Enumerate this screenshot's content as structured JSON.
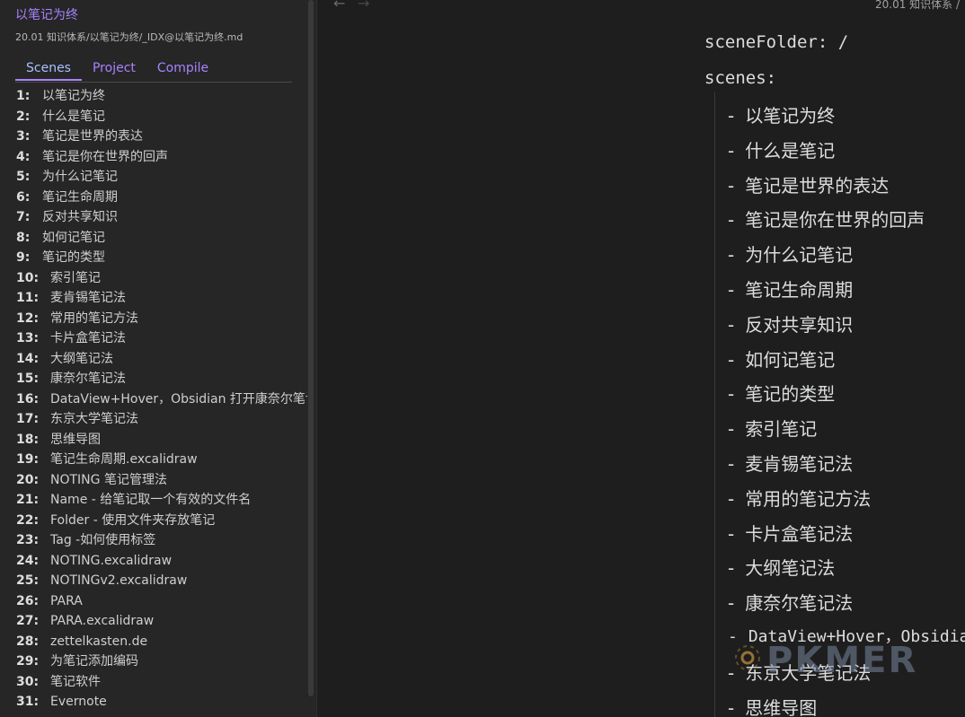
{
  "sidebar": {
    "project_title": "以笔记为终",
    "project_path": "20.01 知识体系/以笔记为终/_IDX@以笔记为终.md",
    "tabs": [
      {
        "label": "Scenes",
        "active": true
      },
      {
        "label": "Project",
        "active": false
      },
      {
        "label": "Compile",
        "active": false
      }
    ],
    "scenes": [
      {
        "num": "1:",
        "name": "以笔记为终"
      },
      {
        "num": "2:",
        "name": "什么是笔记"
      },
      {
        "num": "3:",
        "name": "笔记是世界的表达"
      },
      {
        "num": "4:",
        "name": "笔记是你在世界的回声"
      },
      {
        "num": "5:",
        "name": "为什么记笔记"
      },
      {
        "num": "6:",
        "name": "笔记生命周期"
      },
      {
        "num": "7:",
        "name": "反对共享知识"
      },
      {
        "num": "8:",
        "name": "如何记笔记"
      },
      {
        "num": "9:",
        "name": "笔记的类型"
      },
      {
        "num": "10:",
        "name": "索引笔记"
      },
      {
        "num": "11:",
        "name": "麦肯锡笔记法"
      },
      {
        "num": "12:",
        "name": "常用的笔记方法"
      },
      {
        "num": "13:",
        "name": "卡片盒笔记法"
      },
      {
        "num": "14:",
        "name": "大纲笔记法"
      },
      {
        "num": "15:",
        "name": "康奈尔笔记法"
      },
      {
        "num": "16:",
        "name": "DataView+Hover，Obsidian 打开康奈尔笔记"
      },
      {
        "num": "17:",
        "name": "东京大学笔记法"
      },
      {
        "num": "18:",
        "name": "思维导图"
      },
      {
        "num": "19:",
        "name": "笔记生命周期.excalidraw"
      },
      {
        "num": "20:",
        "name": "NOTING 笔记管理法"
      },
      {
        "num": "21:",
        "name": "Name - 给笔记取一个有效的文件名"
      },
      {
        "num": "22:",
        "name": "Folder - 使用文件夹存放笔记"
      },
      {
        "num": "23:",
        "name": "Tag -如何使用标签"
      },
      {
        "num": "24:",
        "name": "NOTING.excalidraw"
      },
      {
        "num": "25:",
        "name": "NOTINGv2.excalidraw"
      },
      {
        "num": "26:",
        "name": "PARA"
      },
      {
        "num": "27:",
        "name": "PARA.excalidraw"
      },
      {
        "num": "28:",
        "name": "zettelkasten.de"
      },
      {
        "num": "29:",
        "name": "为笔记添加编码"
      },
      {
        "num": "30:",
        "name": "笔记软件"
      },
      {
        "num": "31:",
        "name": "Evernote"
      }
    ]
  },
  "editor": {
    "view_title": "20.01 知识体系 /",
    "line_scene_folder": "sceneFolder: /",
    "line_scenes": "scenes:",
    "dash": "-",
    "items": [
      "以笔记为终",
      "什么是笔记",
      "笔记是世界的表达",
      "笔记是你在世界的回声",
      "为什么记笔记",
      "笔记生命周期",
      "反对共享知识",
      "如何记笔记",
      "笔记的类型",
      "索引笔记",
      "麦肯锡笔记法",
      "常用的笔记方法",
      "卡片盒笔记法",
      "大纲笔记法",
      "康奈尔笔记法",
      "DataView+Hover，Obsidian 打开康奈尔笔记",
      "东京大学笔记法",
      "思维导图"
    ]
  },
  "watermark": {
    "text": "PKMER"
  },
  "colors": {
    "accent": "#a882ff",
    "background": "#1e1e1e",
    "sidebar": "#262626"
  }
}
